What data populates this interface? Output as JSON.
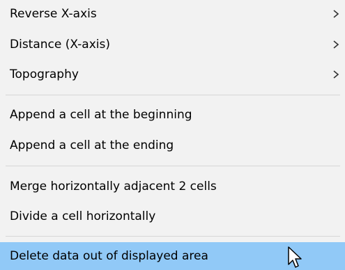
{
  "menu": {
    "groups": [
      {
        "items": [
          {
            "label": "Reverse X-axis",
            "has_submenu": true
          },
          {
            "label": "Distance (X-axis)",
            "has_submenu": true
          },
          {
            "label": "Topography",
            "has_submenu": true
          }
        ]
      },
      {
        "items": [
          {
            "label": "Append a cell at the beginning",
            "has_submenu": false
          },
          {
            "label": "Append a cell at the ending",
            "has_submenu": false
          }
        ]
      },
      {
        "items": [
          {
            "label": "Merge horizontally adjacent 2 cells",
            "has_submenu": false
          },
          {
            "label": "Divide a cell horizontally",
            "has_submenu": false
          }
        ]
      },
      {
        "items": [
          {
            "label": "Delete data out of displayed area",
            "has_submenu": false,
            "highlighted": true
          }
        ]
      }
    ]
  },
  "colors": {
    "menu_background": "#f2f2f2",
    "highlight": "#91c9f7",
    "separator": "#d6d6d6",
    "text": "#000000"
  },
  "icons": {
    "submenu_arrow": "chevron-right-icon",
    "cursor": "mouse-pointer-icon"
  }
}
